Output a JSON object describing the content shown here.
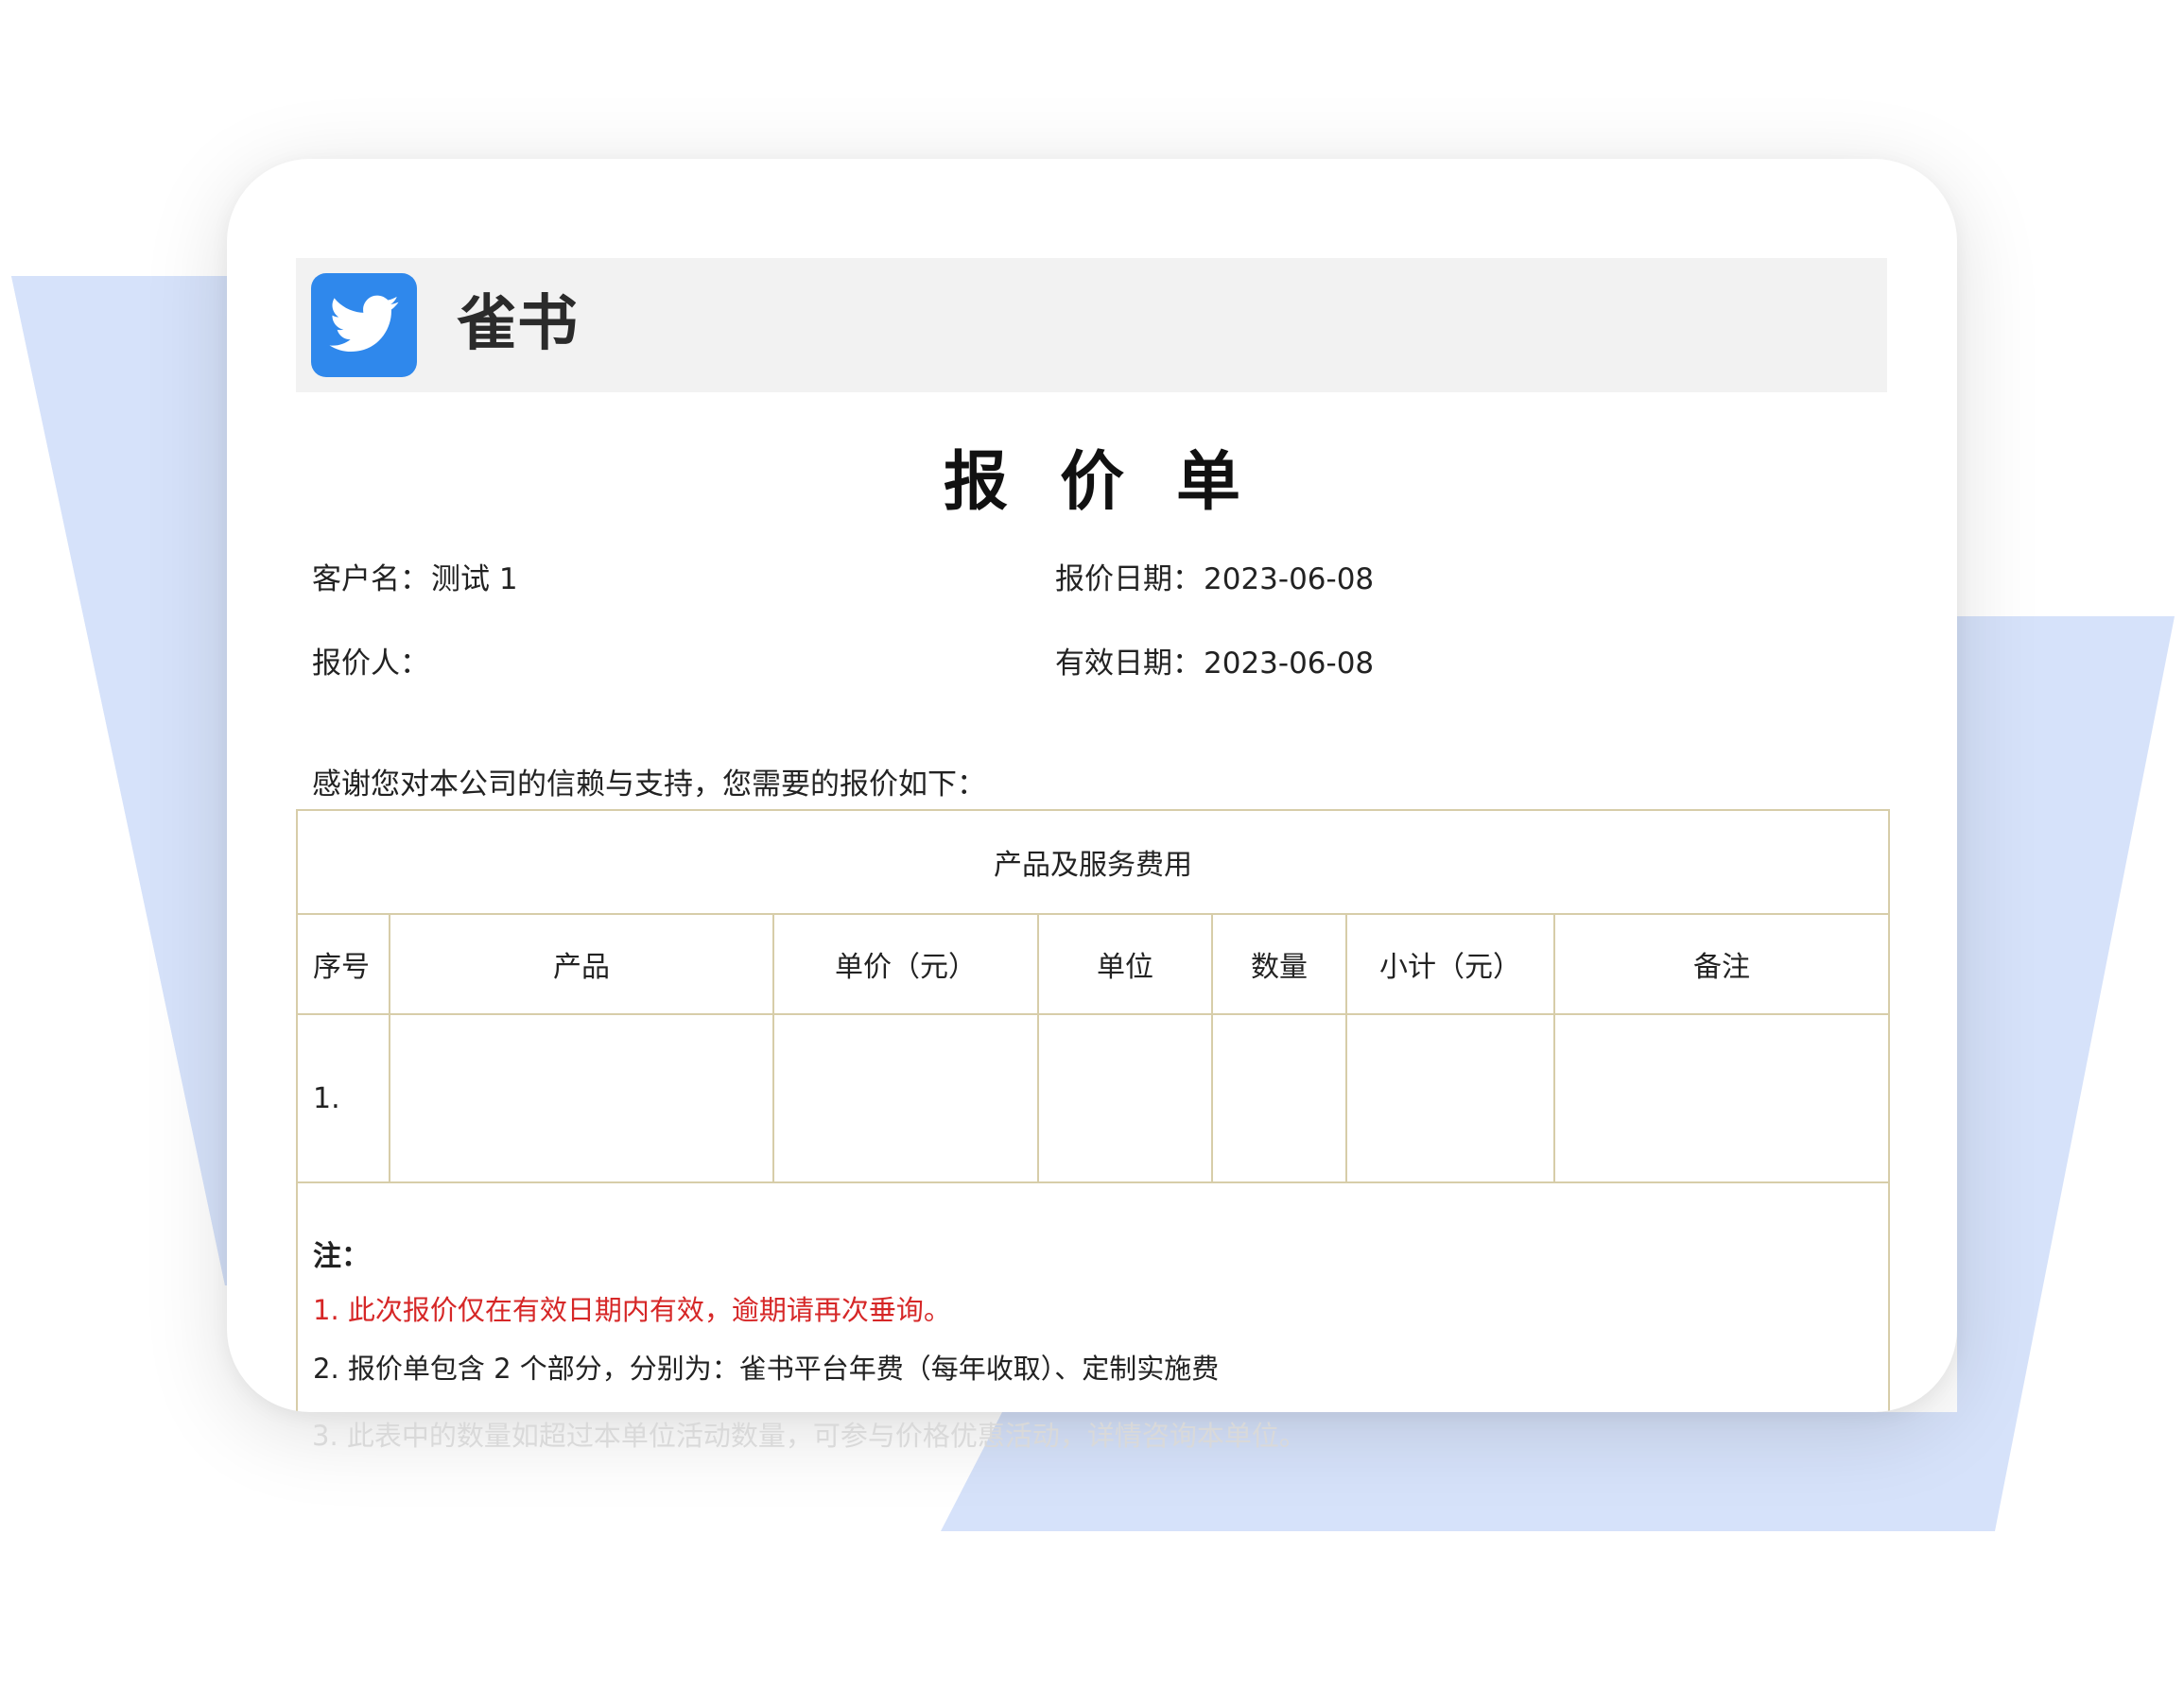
{
  "brand": {
    "name": "雀书",
    "logo_icon": "bird-icon",
    "logo_color": "#2f88ec"
  },
  "document": {
    "title": "报价单",
    "customer": {
      "label": "客户名：",
      "value": "测试 1"
    },
    "quote_date": {
      "label": "报价日期：",
      "value": "2023-06-08"
    },
    "quoter": {
      "label": "报价人：",
      "value": ""
    },
    "valid_date": {
      "label": "有效日期：",
      "value": "2023-06-08"
    },
    "intro": "感谢您对本公司的信赖与支持，您需要的报价如下："
  },
  "table": {
    "title": "产品及服务费用",
    "headers": [
      "序号",
      "产品",
      "单价（元）",
      "单位",
      "数量",
      "小计（元）",
      "备注"
    ],
    "rows": [
      [
        "1.",
        "",
        "",
        "",
        "",
        "",
        ""
      ]
    ]
  },
  "notes": {
    "heading": "注：",
    "items": [
      "1.   此次报价仅在有效日期内有效，逾期请再次垂询。",
      "2.   报价单包含 2 个部分，分别为：雀书平台年费（每年收取）、定制实施费",
      "3.   此表中的数量如超过本单位活动数量，可参与价格优惠活动，详情咨询本单位。"
    ]
  },
  "colors": {
    "accent_bg": "#d6e2fa",
    "border": "#d7cda9",
    "note_red": "#d62727"
  }
}
